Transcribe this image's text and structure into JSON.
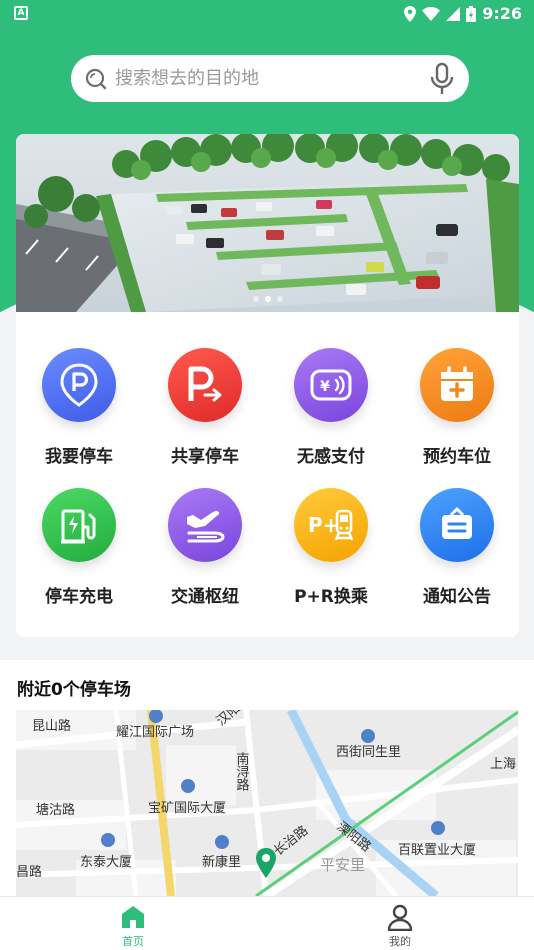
{
  "status_bar": {
    "time": "9:26",
    "left_icon": "A"
  },
  "search": {
    "placeholder": "搜索想去的目的地",
    "icon": "search-icon",
    "voice_icon": "microphone-icon"
  },
  "banner": {
    "slide_count": 3,
    "active_index": 1
  },
  "services": [
    {
      "label": "我要停车",
      "icon": "parking-pin-icon",
      "color": "#4f6ff0"
    },
    {
      "label": "共享停车",
      "icon": "shared-parking-icon",
      "color": "#ee3e3e"
    },
    {
      "label": "无感支付",
      "icon": "contactless-pay-icon",
      "color": "#8e5ae8"
    },
    {
      "label": "预约车位",
      "icon": "calendar-plus-icon",
      "color": "#f58a1f"
    },
    {
      "label": "停车充电",
      "icon": "ev-charging-icon",
      "color": "#34c44f"
    },
    {
      "label": "交通枢纽",
      "icon": "plane-train-icon",
      "color": "#8e5ae8"
    },
    {
      "label": "P+R换乘",
      "icon": "park-ride-icon",
      "color": "#f7b318"
    },
    {
      "label": "通知公告",
      "icon": "notice-icon",
      "color": "#2f85f0"
    }
  ],
  "nearby": {
    "title": "附近0个停车场"
  },
  "map": {
    "labels": {
      "kunshan": "昆山路",
      "yaojiang": "耀江国际广场",
      "hanyang": "汉阳",
      "nanxun": "南浔路",
      "xijie": "西街同生里",
      "shanghai": "上海",
      "tanggu": "塘沽路",
      "baokuang": "宝矿国际大厦",
      "changzhi": "长治路",
      "liyang": "溧阳路",
      "bailian": "百联置业大厦",
      "dongtai": "东泰大厦",
      "xinkang": "新康里",
      "pingan": "平安里",
      "changlu": "昌路"
    }
  },
  "tabbar": {
    "home_label": "首页",
    "mine_label": "我的",
    "active_color": "#2ebd7b",
    "inactive_color": "#555555"
  }
}
